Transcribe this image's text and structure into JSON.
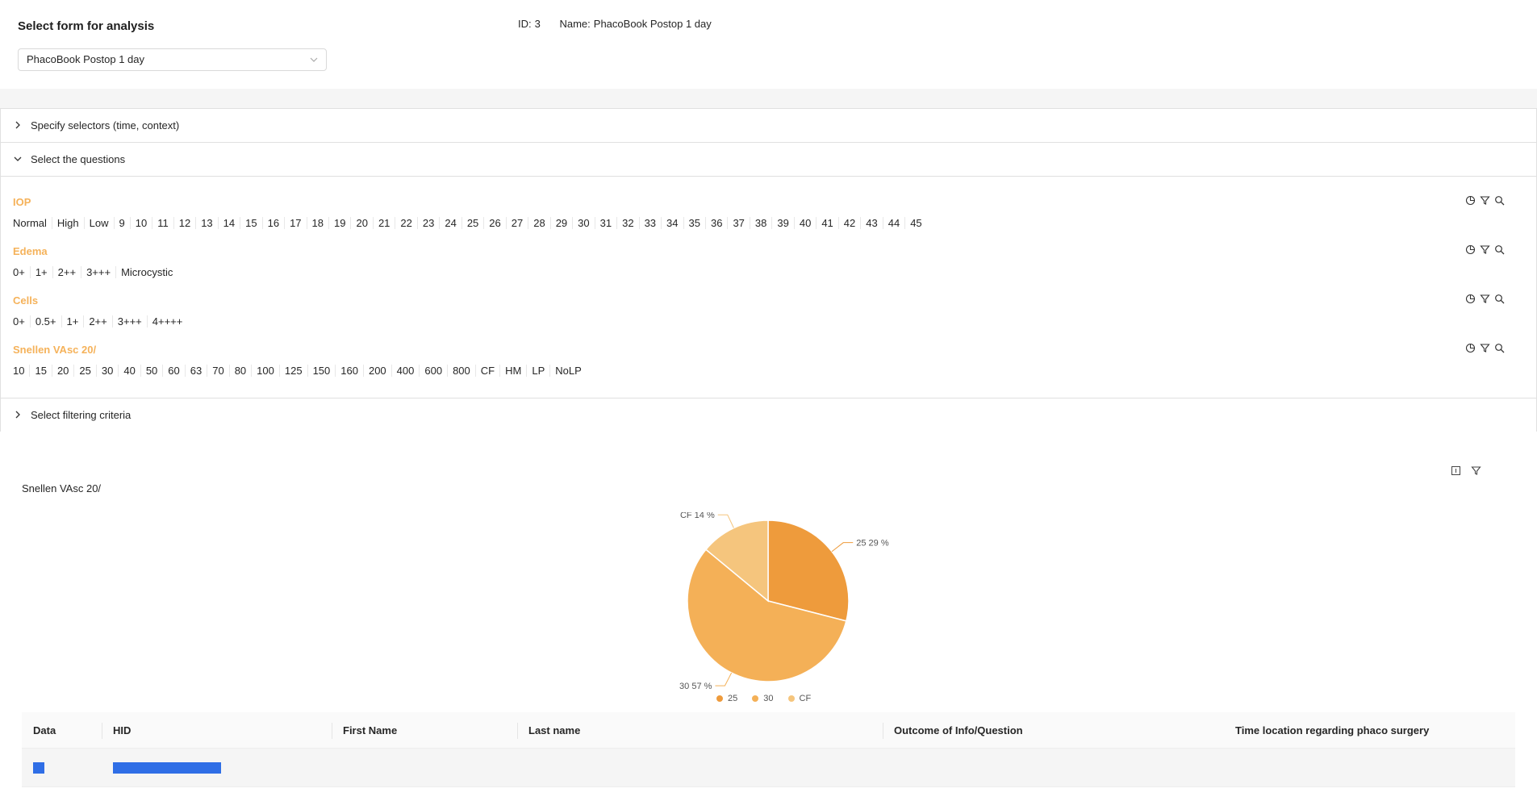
{
  "form_selector": {
    "title": "Select form for analysis",
    "id_label": "ID:",
    "id_value": "3",
    "name_label": "Name:",
    "name_value": "PhacoBook Postop 1 day",
    "selected": "PhacoBook Postop 1 day"
  },
  "sections": {
    "selectors_label": "Specify selectors (time, context)",
    "questions_label": "Select the questions",
    "filtering_label": "Select filtering criteria"
  },
  "questions": [
    {
      "title": "IOP",
      "options": [
        "Normal",
        "High",
        "Low",
        "9",
        "10",
        "11",
        "12",
        "13",
        "14",
        "15",
        "16",
        "17",
        "18",
        "19",
        "20",
        "21",
        "22",
        "23",
        "24",
        "25",
        "26",
        "27",
        "28",
        "29",
        "30",
        "31",
        "32",
        "33",
        "34",
        "35",
        "36",
        "37",
        "38",
        "39",
        "40",
        "41",
        "42",
        "43",
        "44",
        "45"
      ]
    },
    {
      "title": "Edema",
      "options": [
        "0+",
        "1+",
        "2++",
        "3+++",
        "Microcystic"
      ]
    },
    {
      "title": "Cells",
      "options": [
        "0+",
        "0.5+",
        "1+",
        "2++",
        "3+++",
        "4++++"
      ]
    },
    {
      "title": "Snellen VAsc 20/",
      "options": [
        "10",
        "15",
        "20",
        "25",
        "30",
        "40",
        "50",
        "60",
        "63",
        "70",
        "80",
        "100",
        "125",
        "150",
        "160",
        "200",
        "400",
        "600",
        "800",
        "CF",
        "HM",
        "LP",
        "NoLP"
      ]
    }
  ],
  "icons": [
    "pie-chart-icon",
    "filter-icon",
    "search-icon"
  ],
  "result_icons": [
    "table-icon",
    "filter-icon"
  ],
  "chart_data": {
    "type": "pie",
    "title": "Snellen VAsc 20/",
    "slices": [
      {
        "label": "25",
        "percent": 29,
        "color": "#ee9b3c"
      },
      {
        "label": "30",
        "percent": 57,
        "color": "#f4b057"
      },
      {
        "label": "CF",
        "percent": 14,
        "color": "#f5c57d"
      }
    ],
    "slice_labels": [
      "25 29 %",
      "30 57 %",
      "CF 14 %"
    ],
    "legend": [
      "25",
      "30",
      "CF"
    ]
  },
  "table": {
    "columns": [
      "Data",
      "HID",
      "First Name",
      "Last name",
      "Outcome of Info/Question",
      "Time location regarding phaco surgery"
    ],
    "accent": "#2f6ee6"
  }
}
